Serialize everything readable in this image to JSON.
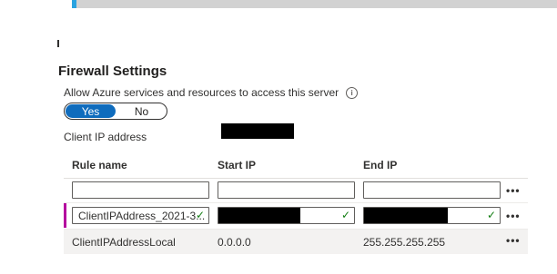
{
  "firewall": {
    "title": "Firewall Settings",
    "allow_label": "Allow Azure services and resources to access this server",
    "info_icon": "ⓘ",
    "toggle": {
      "yes": "Yes",
      "no": "No",
      "selected": "Yes"
    },
    "client_ip_label": "Client IP address"
  },
  "table": {
    "columns": [
      "Rule name",
      "Start IP",
      "End IP"
    ],
    "new_row": {
      "rule_name": "",
      "start_ip": "",
      "end_ip": ""
    },
    "editing_row": {
      "rule_name": "ClientIPAddress_2021-3...",
      "check": "✓"
    },
    "rows": [
      {
        "rule_name": "ClientIPAddressLocal",
        "start_ip": "0.0.0.0",
        "end_ip": "255.255.255.255"
      }
    ],
    "more": "•••"
  },
  "colors": {
    "accent": "#0f6cbd",
    "row_indicator": "#b4009e",
    "valid": "#107c10"
  }
}
